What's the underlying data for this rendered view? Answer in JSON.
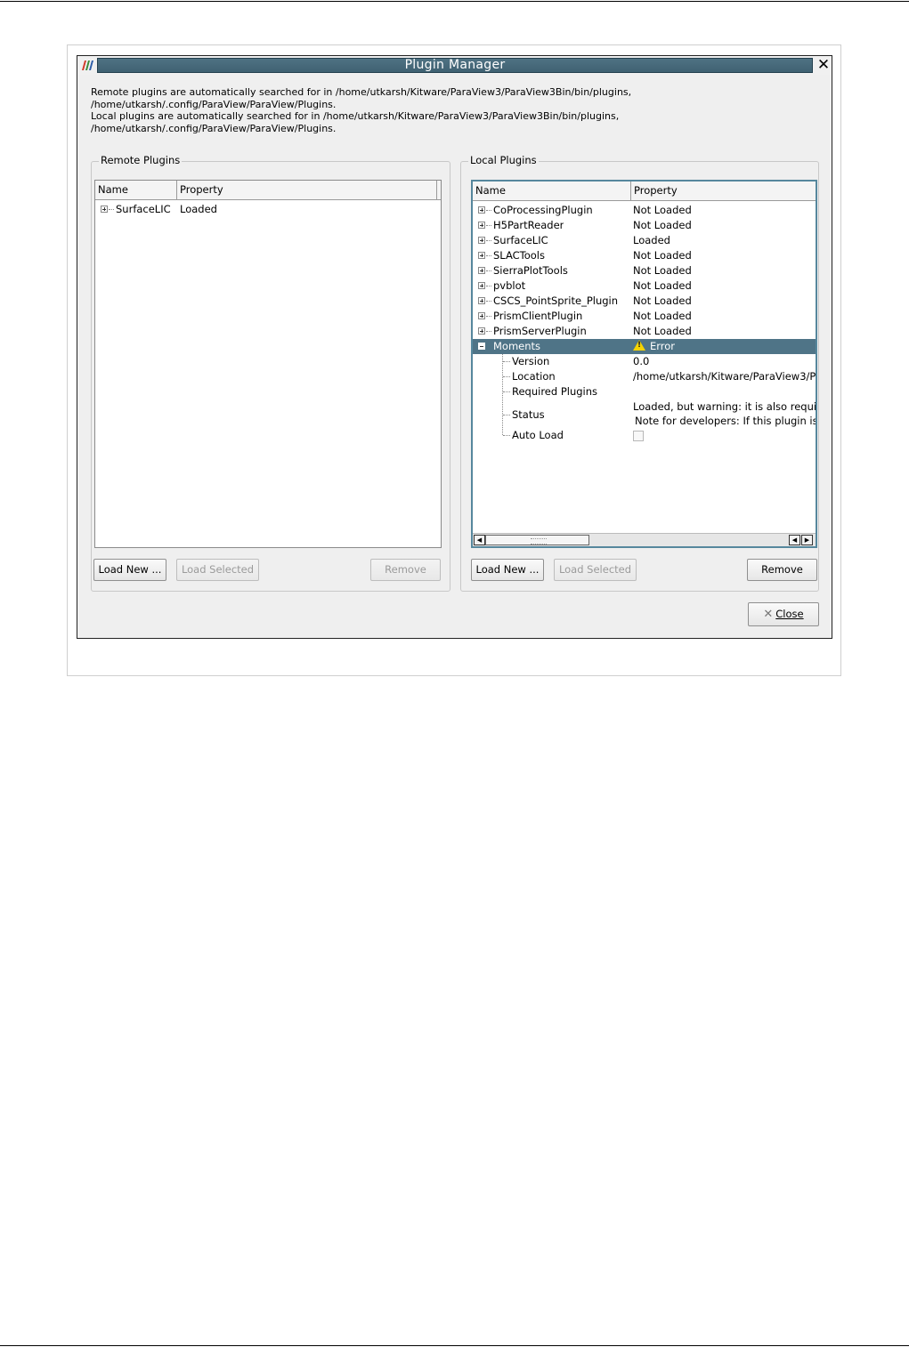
{
  "dialog": {
    "title": "Plugin Manager",
    "info_lines": [
      "Remote plugins are automatically searched for in /home/utkarsh/Kitware/ParaView3/ParaView3Bin/bin/plugins,",
      "/home/utkarsh/.config/ParaView/ParaView/Plugins.",
      "Local plugins are automatically searched for in /home/utkarsh/Kitware/ParaView3/ParaView3Bin/bin/plugins,",
      "/home/utkarsh/.config/ParaView/ParaView/Plugins."
    ],
    "close_label": "Close"
  },
  "remote": {
    "title": "Remote Plugins",
    "columns": [
      "Name",
      "Property"
    ],
    "rows": [
      {
        "name": "SurfaceLIC",
        "property": "Loaded"
      }
    ],
    "buttons": {
      "load_new": "Load New ...",
      "load_selected": "Load Selected",
      "remove": "Remove"
    }
  },
  "local": {
    "title": "Local Plugins",
    "columns": [
      "Name",
      "Property"
    ],
    "rows": [
      {
        "name": "CoProcessingPlugin",
        "property": "Not Loaded"
      },
      {
        "name": "H5PartReader",
        "property": "Not Loaded"
      },
      {
        "name": "SurfaceLIC",
        "property": "Loaded"
      },
      {
        "name": "SLACTools",
        "property": "Not Loaded"
      },
      {
        "name": "SierraPlotTools",
        "property": "Not Loaded"
      },
      {
        "name": "pvblot",
        "property": "Not Loaded"
      },
      {
        "name": "CSCS_PointSprite_Plugin",
        "property": "Not Loaded"
      },
      {
        "name": "PrismClientPlugin",
        "property": "Not Loaded"
      },
      {
        "name": "PrismServerPlugin",
        "property": "Not Loaded"
      }
    ],
    "selected": {
      "name": "Moments",
      "property": "Error",
      "icon": "warning-icon"
    },
    "details": {
      "version_label": "Version",
      "version_value": "0.0",
      "location_label": "Location",
      "location_value": "/home/utkarsh/Kitware/ParaView3/P",
      "required_label": "Required Plugins",
      "status_label": "Status",
      "status_line1": "Loaded, but warning: it is also requi",
      "status_line2": "Note for developers: If this plugin is",
      "autoload_label": "Auto Load"
    },
    "buttons": {
      "load_new": "Load New ...",
      "load_selected": "Load Selected",
      "remove": "Remove"
    }
  },
  "colors": {
    "title_bar": "#476a7b",
    "selection": "#4f7487",
    "warning": "#f5d300"
  }
}
